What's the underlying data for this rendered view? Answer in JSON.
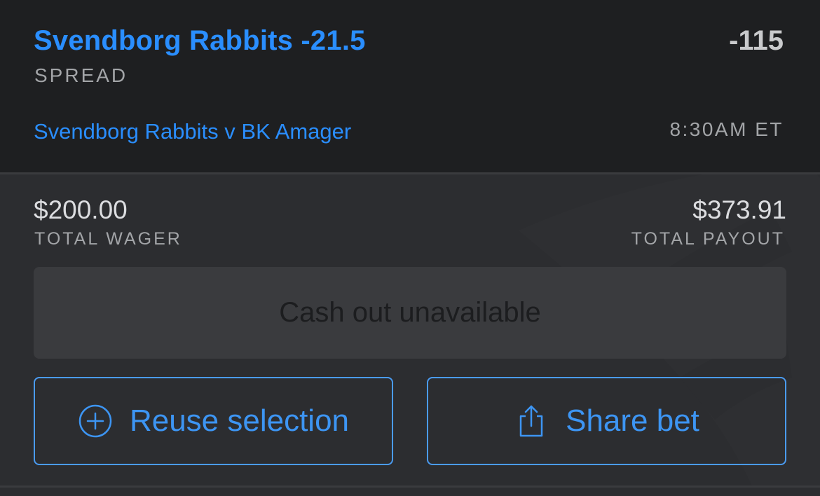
{
  "bet": {
    "selection": "Svendborg Rabbits -21.5",
    "market_type": "SPREAD",
    "odds": "-115",
    "event": "Svendborg Rabbits v BK Amager",
    "start_time": "8:30AM ET"
  },
  "totals": {
    "wager_amount": "$200.00",
    "wager_label": "TOTAL WAGER",
    "payout_amount": "$373.91",
    "payout_label": "TOTAL PAYOUT"
  },
  "cashout": {
    "label": "Cash out unavailable",
    "enabled": false
  },
  "actions": {
    "reuse": {
      "label": "Reuse selection",
      "icon": "plus-circle-icon"
    },
    "share": {
      "label": "Share bet",
      "icon": "share-icon"
    }
  },
  "colors": {
    "accent": "#2a8eff",
    "button_border": "#4a9bf2",
    "background_top": "#1e1f21",
    "background_bottom": "#2c2d30",
    "muted_text": "#a3a5a8"
  }
}
